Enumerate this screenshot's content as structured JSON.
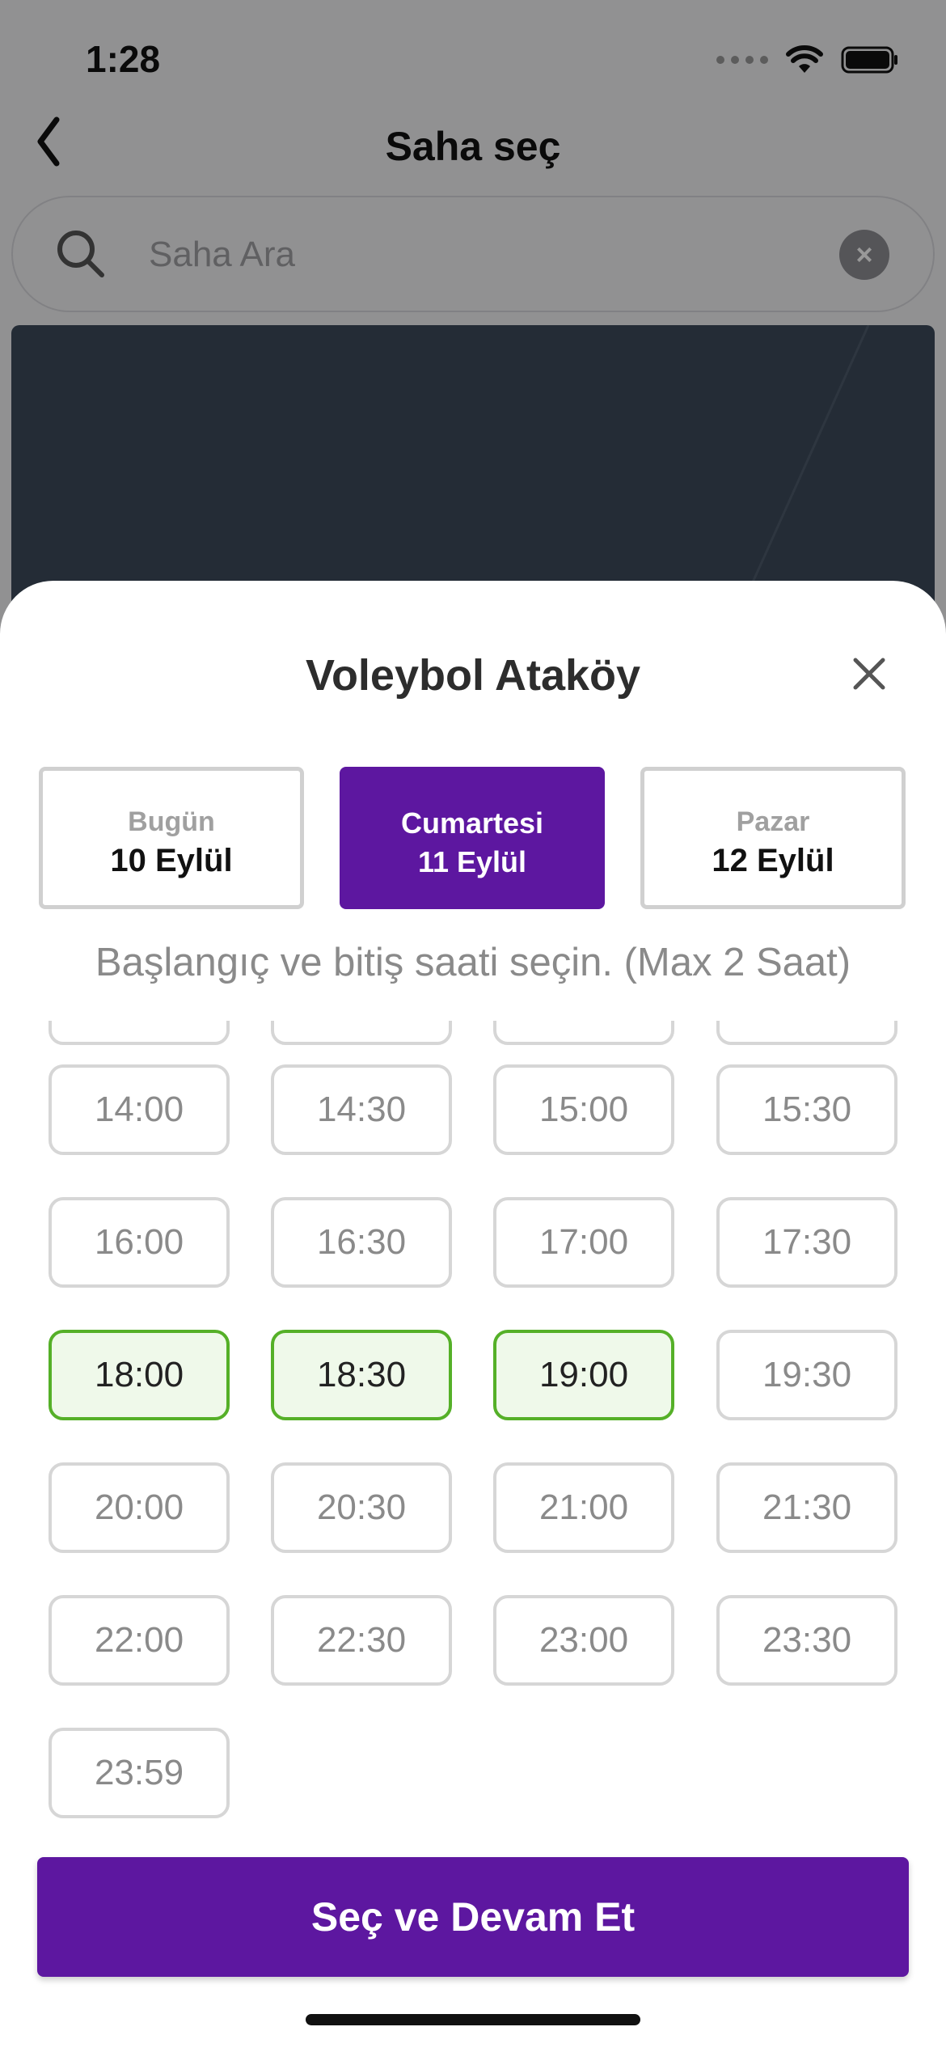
{
  "status_bar": {
    "time": "1:28"
  },
  "nav": {
    "title": "Saha seç"
  },
  "search": {
    "placeholder": "Saha Ara"
  },
  "sheet": {
    "title": "Voleybol Ataköy",
    "days": [
      {
        "name": "Bugün",
        "date": "10 Eylül",
        "selected": false
      },
      {
        "name": "Cumartesi",
        "date": "11 Eylül",
        "selected": true
      },
      {
        "name": "Pazar",
        "date": "12 Eylül",
        "selected": false
      }
    ],
    "instruction": "Başlangıç ve bitiş saati seçin. (Max 2 Saat)",
    "slots": [
      {
        "time": "14:00",
        "selected": false
      },
      {
        "time": "14:30",
        "selected": false
      },
      {
        "time": "15:00",
        "selected": false
      },
      {
        "time": "15:30",
        "selected": false
      },
      {
        "time": "16:00",
        "selected": false
      },
      {
        "time": "16:30",
        "selected": false
      },
      {
        "time": "17:00",
        "selected": false
      },
      {
        "time": "17:30",
        "selected": false
      },
      {
        "time": "18:00",
        "selected": true
      },
      {
        "time": "18:30",
        "selected": true
      },
      {
        "time": "19:00",
        "selected": true
      },
      {
        "time": "19:30",
        "selected": false
      },
      {
        "time": "20:00",
        "selected": false
      },
      {
        "time": "20:30",
        "selected": false
      },
      {
        "time": "21:00",
        "selected": false
      },
      {
        "time": "21:30",
        "selected": false
      },
      {
        "time": "22:00",
        "selected": false
      },
      {
        "time": "22:30",
        "selected": false
      },
      {
        "time": "23:00",
        "selected": false
      },
      {
        "time": "23:30",
        "selected": false
      },
      {
        "time": "23:59",
        "selected": false
      }
    ],
    "submit_label": "Seç ve Devam Et"
  },
  "colors": {
    "accent": "#5d17a0",
    "selected_border": "#55b028",
    "selected_fill": "#eff9ea"
  }
}
